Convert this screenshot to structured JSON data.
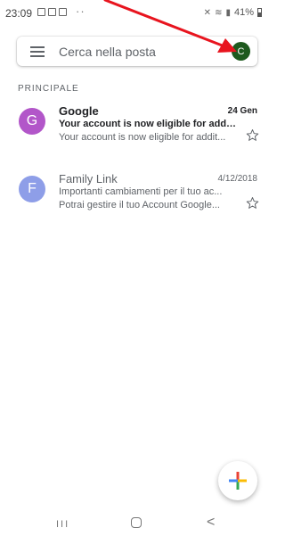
{
  "status_bar": {
    "time": "23:09",
    "dots": "··",
    "battery_percent": "41%"
  },
  "search": {
    "placeholder": "Cerca nella posta",
    "avatar_letter": "C",
    "avatar_color": "#1e5a1e"
  },
  "section_label": "PRINCIPALE",
  "emails": [
    {
      "sender": "Google",
      "date": "24 Gen",
      "subject": "Your account is now eligible for addi...",
      "snippet": "Your account is now eligible for addit...",
      "avatar_letter": "G",
      "avatar_color": "#b256c9",
      "unread": true
    },
    {
      "sender": "Family Link",
      "date": "4/12/2018",
      "subject": "Importanti cambiamenti per il tuo ac...",
      "snippet": "Potrai gestire il tuo Account Google...",
      "avatar_letter": "F",
      "avatar_color": "#8e9ee8",
      "unread": false
    }
  ],
  "nav_bar": {
    "recent": "III",
    "back": "<"
  },
  "colors": {
    "annotation_arrow": "#e8141e"
  }
}
